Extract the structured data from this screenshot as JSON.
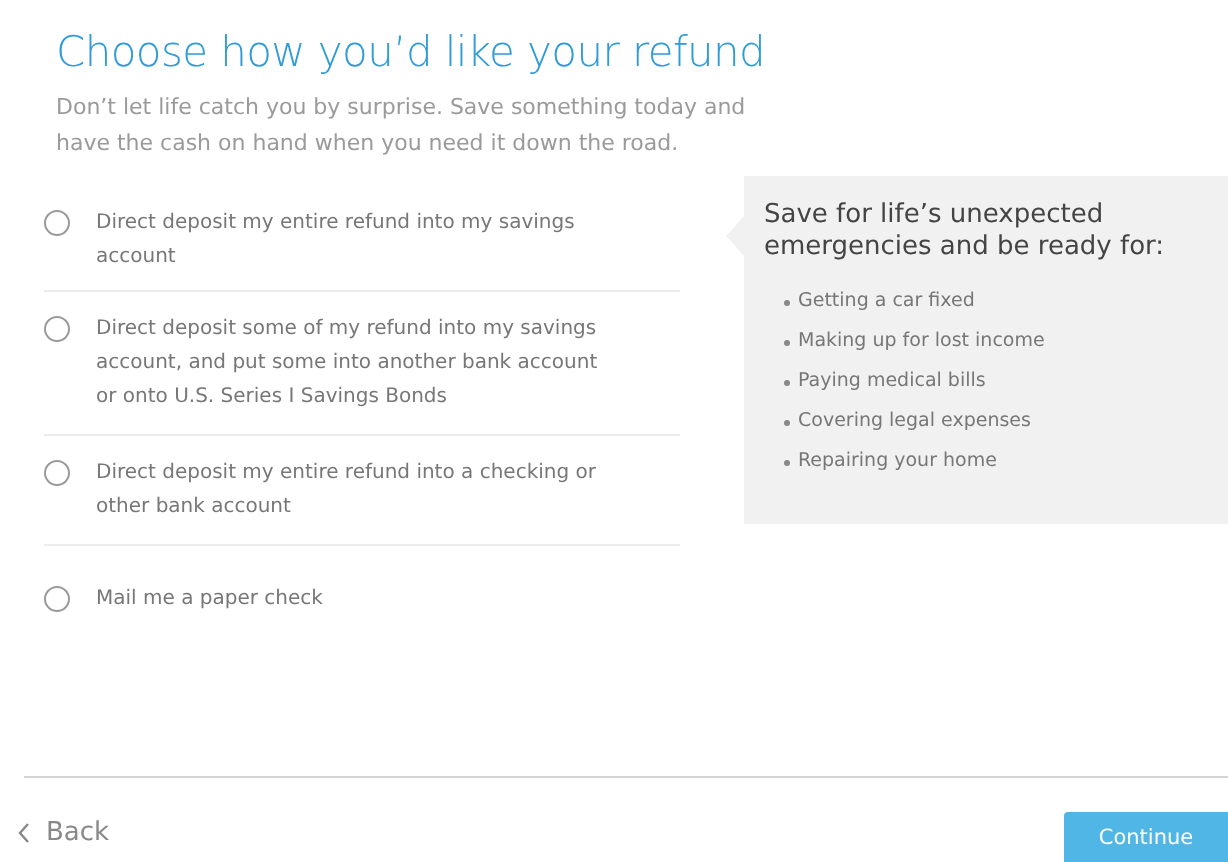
{
  "title": "Choose how you’d like your refund",
  "subtitle": "Don’t let life catch you by surprise. Save something today and have the cash on hand when you need it down the road.",
  "options": [
    {
      "label": "Direct deposit my entire refund into my savings account",
      "selected": false
    },
    {
      "label": "Direct deposit some of my refund into my savings account, and put some into another bank account or onto U.S. Series I Savings Bonds",
      "selected": false
    },
    {
      "label": "Direct deposit my entire refund into a checking or other bank account",
      "selected": false
    },
    {
      "label": "Mail me a paper check",
      "selected": false
    }
  ],
  "tip": {
    "heading": "Save for life’s unexpected emergencies and be ready for:",
    "items": [
      "Getting a car fixed",
      "Making up for lost income",
      "Paying medical bills",
      "Covering legal expenses",
      "Repairing your home"
    ]
  },
  "footer": {
    "back": "Back",
    "continue": "Continue"
  }
}
